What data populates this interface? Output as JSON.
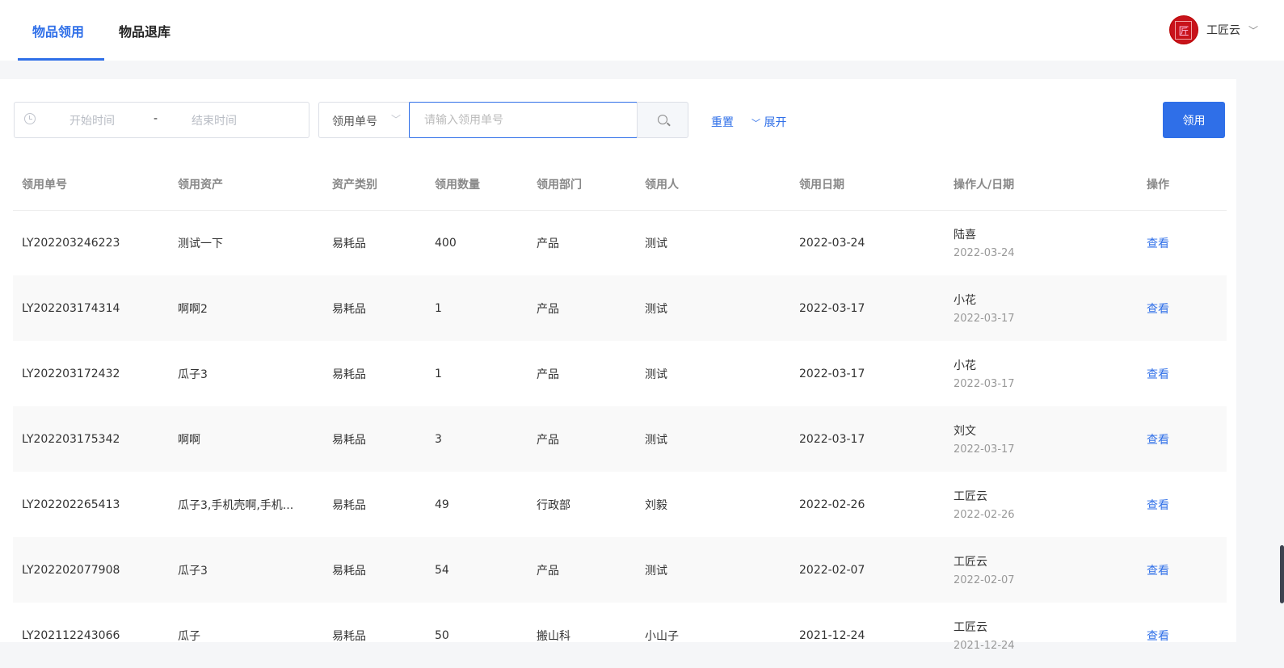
{
  "tabs": [
    {
      "label": "物品领用"
    },
    {
      "label": "物品退库"
    }
  ],
  "user": {
    "name": "工匠云",
    "avatar_text": "匠"
  },
  "filters": {
    "start_placeholder": "开始时间",
    "separator": "-",
    "end_placeholder": "结束时间",
    "field_select": "领用单号",
    "search_placeholder": "请输入领用单号",
    "reset": "重置",
    "expand": "展开",
    "primary": "领用"
  },
  "table": {
    "columns": [
      "领用单号",
      "领用资产",
      "资产类别",
      "领用数量",
      "领用部门",
      "领用人",
      "领用日期",
      "操作人/日期",
      "操作"
    ],
    "rows": [
      {
        "id": "LY202203246223",
        "asset": "测试一下",
        "category": "易耗品",
        "qty": "400",
        "dept": "产品",
        "person": "测试",
        "date": "2022-03-24",
        "operator": "陆喜",
        "op_date": "2022-03-24",
        "action": "查看"
      },
      {
        "id": "LY202203174314",
        "asset": "啊啊2",
        "category": "易耗品",
        "qty": "1",
        "dept": "产品",
        "person": "测试",
        "date": "2022-03-17",
        "operator": "小花",
        "op_date": "2022-03-17",
        "action": "查看"
      },
      {
        "id": "LY202203172432",
        "asset": "瓜子3",
        "category": "易耗品",
        "qty": "1",
        "dept": "产品",
        "person": "测试",
        "date": "2022-03-17",
        "operator": "小花",
        "op_date": "2022-03-17",
        "action": "查看"
      },
      {
        "id": "LY202203175342",
        "asset": "啊啊",
        "category": "易耗品",
        "qty": "3",
        "dept": "产品",
        "person": "测试",
        "date": "2022-03-17",
        "operator": "刘文",
        "op_date": "2022-03-17",
        "action": "查看"
      },
      {
        "id": "LY202202265413",
        "asset": "瓜子3,手机壳啊,手机...",
        "category": "易耗品",
        "qty": "49",
        "dept": "行政部",
        "person": "刘毅",
        "date": "2022-02-26",
        "operator": "工匠云",
        "op_date": "2022-02-26",
        "action": "查看"
      },
      {
        "id": "LY202202077908",
        "asset": "瓜子3",
        "category": "易耗品",
        "qty": "54",
        "dept": "产品",
        "person": "测试",
        "date": "2022-02-07",
        "operator": "工匠云",
        "op_date": "2022-02-07",
        "action": "查看"
      },
      {
        "id": "LY202112243066",
        "asset": "瓜子",
        "category": "易耗品",
        "qty": "50",
        "dept": "搬山科",
        "person": "小山子",
        "date": "2021-12-24",
        "operator": "工匠云",
        "op_date": "2021-12-24",
        "action": "查看"
      }
    ]
  }
}
